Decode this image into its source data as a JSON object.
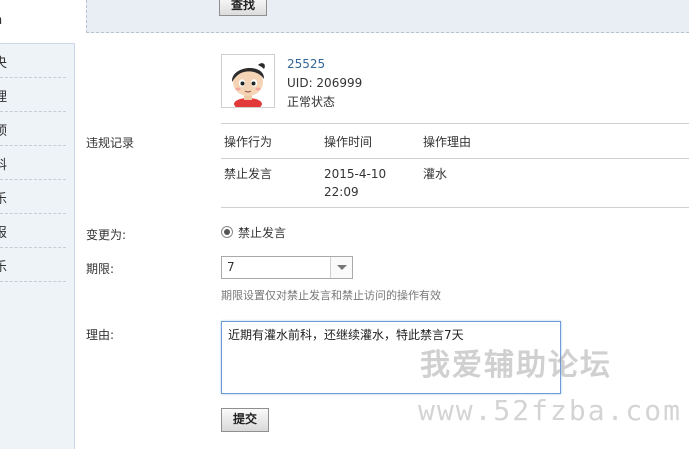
{
  "sidebar": {
    "active_label": "n",
    "items": [
      {
        "label": "央"
      },
      {
        "label": "理"
      },
      {
        "label": "顶"
      },
      {
        "label": "科"
      },
      {
        "label": "乐"
      },
      {
        "label": "报"
      },
      {
        "label": "乐"
      }
    ]
  },
  "search": {
    "button_label": "查找"
  },
  "user": {
    "name": "25525",
    "uid": "UID: 206999",
    "status": "正常状态",
    "avatar_icon": "cartoon-avatar-icon"
  },
  "violation": {
    "label": "违规记录",
    "headers": [
      "操作行为",
      "操作时间",
      "操作理由"
    ],
    "rows": [
      {
        "action": "禁止发言",
        "date": "2015-4-10",
        "time": "22:09",
        "reason": "灌水"
      }
    ]
  },
  "change": {
    "label": "变更为:",
    "option": "禁止发言"
  },
  "duration": {
    "label": "期限:",
    "value": "7",
    "hint": "期限设置仅对禁止发言和禁止访问的操作有效"
  },
  "reason": {
    "label": "理由:",
    "value": "近期有灌水前科，还继续灌水，特此禁言7天"
  },
  "submit": {
    "label": "提交"
  },
  "watermark": {
    "line1": "我爱辅助论坛",
    "line2": "www.52fzba.com"
  },
  "colors": {
    "link": "#336699",
    "sidebar_bg": "#eef3f8",
    "focus_border": "#6f9bd6"
  }
}
